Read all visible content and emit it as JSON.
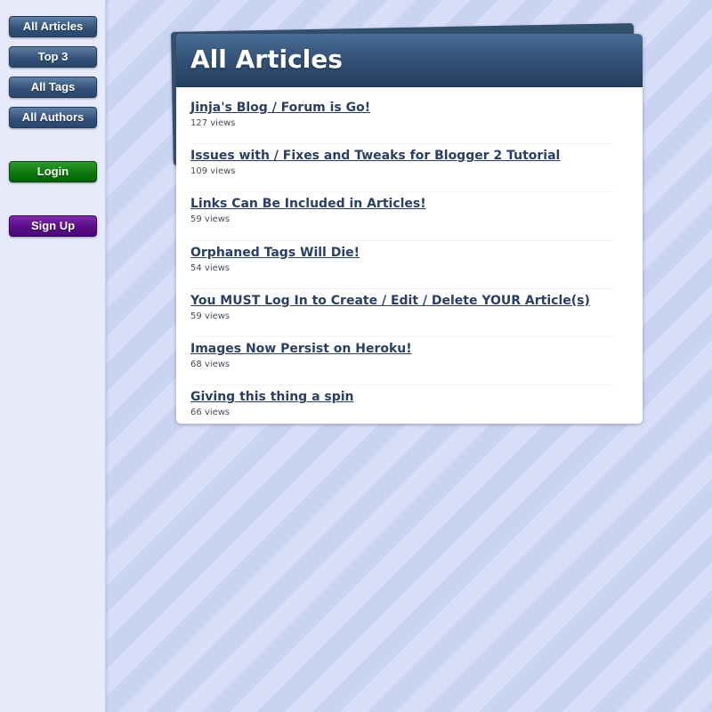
{
  "sidebar": {
    "nav": [
      {
        "label": "All Articles"
      },
      {
        "label": "Top 3"
      },
      {
        "label": "All Tags"
      },
      {
        "label": "All Authors"
      }
    ],
    "login_label": "Login",
    "signup_label": "Sign Up"
  },
  "main": {
    "title": "All Articles",
    "articles": [
      {
        "title": "Jinja's Blog / Forum is Go!",
        "views": "127 views"
      },
      {
        "title": "Issues with / Fixes and Tweaks for Blogger 2 Tutorial",
        "views": "109 views"
      },
      {
        "title": "Links Can Be Included in Articles!",
        "views": "59 views"
      },
      {
        "title": "Orphaned Tags Will Die!",
        "views": "54 views"
      },
      {
        "title": "You MUST Log In to Create / Edit / Delete YOUR Article(s)",
        "views": "59 views"
      },
      {
        "title": "Images Now Persist on Heroku!",
        "views": "68 views"
      },
      {
        "title": "Giving this thing a spin",
        "views": "66 views"
      }
    ]
  },
  "colors": {
    "nav_blue": "#34527a",
    "login_green": "#0d7a0d",
    "signup_purple": "#5a0d88",
    "header_blue": "#2f4d72",
    "link_color": "#2a3f63"
  }
}
